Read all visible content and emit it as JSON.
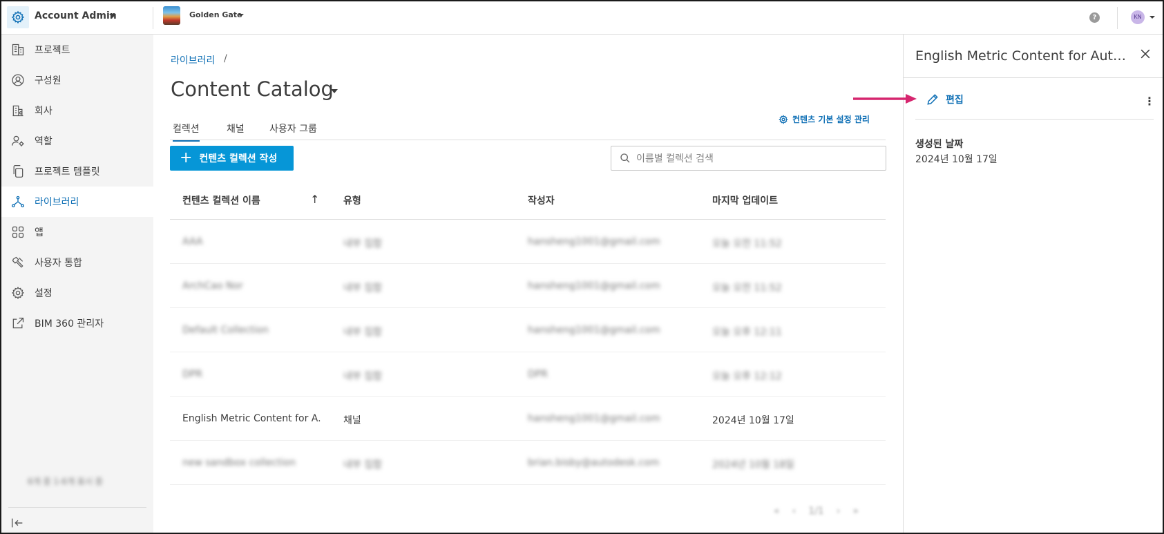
{
  "topbar": {
    "app_title": "Account Admin",
    "project_name": "Golden Gate",
    "help_label": "?",
    "avatar_initials": "KN"
  },
  "sidebar": {
    "items": [
      {
        "label": "프로젝트",
        "icon": "building-icon",
        "active": false
      },
      {
        "label": "구성원",
        "icon": "user-circle-icon",
        "active": false
      },
      {
        "label": "회사",
        "icon": "company-icon",
        "active": false
      },
      {
        "label": "역할",
        "icon": "user-gear-icon",
        "active": false
      },
      {
        "label": "프로젝트 템플릿",
        "icon": "copy-icon",
        "active": false
      },
      {
        "label": "라이브러리",
        "icon": "library-icon",
        "active": true
      },
      {
        "label": "앱",
        "icon": "apps-grid-icon",
        "active": false
      },
      {
        "label": "사용자 통합",
        "icon": "hammer-icon",
        "active": false
      },
      {
        "label": "설정",
        "icon": "gear-icon",
        "active": false
      },
      {
        "label": "BIM 360 관리자",
        "icon": "external-link-icon",
        "active": false
      }
    ]
  },
  "main": {
    "breadcrumb": "라이브러리",
    "breadcrumb_sep": "/",
    "title": "Content Catalog",
    "tabs": [
      "컬렉션",
      "채널",
      "사용자 그룹"
    ],
    "active_tab": 0,
    "settings_link": "컨텐츠 기본 설정 관리",
    "create_button": "컨텐츠 컬렉션 작성",
    "search_placeholder": "이름별 컬렉션 검색",
    "table": {
      "headers": [
        "컨텐츠 컬렉션 이름",
        "유형",
        "작성자",
        "마지막 업데이트"
      ],
      "rows": [
        {
          "name": "AAA",
          "type": "내부 집합",
          "author": "hansheng1001@gmail.com",
          "updated": "오늘 오전 11:52",
          "blurred": true
        },
        {
          "name": "ArchCao Nor",
          "type": "내부 집합",
          "author": "hansheng1001@gmail.com",
          "updated": "오늘 오전 11:52",
          "blurred": true
        },
        {
          "name": "Default Collection",
          "type": "내부 집합",
          "author": "hansheng1001@gmail.com",
          "updated": "오늘 오후 12:11",
          "blurred": true
        },
        {
          "name": "DPR",
          "type": "내부 집합",
          "author": "DPR",
          "updated": "오늘 오후 12:12",
          "blurred": true
        },
        {
          "name": "English Metric Content for A...",
          "type": "채널",
          "author": "hansheng1001@gmail.com",
          "updated": "2024년 10월 17일",
          "blurred": false,
          "author_blurred": true
        },
        {
          "name": "new sandbox collection",
          "type": "내부 집합",
          "author": "brian.bisby@autodesk.com",
          "updated": "2024년 10월 18일",
          "blurred": true
        }
      ]
    },
    "footer_count": "6개 중 1-6개 표시 중",
    "pager": [
      "«",
      "‹",
      "1/1",
      "›",
      "»"
    ]
  },
  "panel": {
    "title": "English Metric Content for Autodesk",
    "edit_label": "편집",
    "more_label": "⋮",
    "created_label": "생성된 날짜",
    "created_value": "2024년 10월 17일"
  },
  "colors": {
    "accent": "#0696d7",
    "link": "#0e6fb5",
    "annotation_arrow": "#d6266f"
  }
}
